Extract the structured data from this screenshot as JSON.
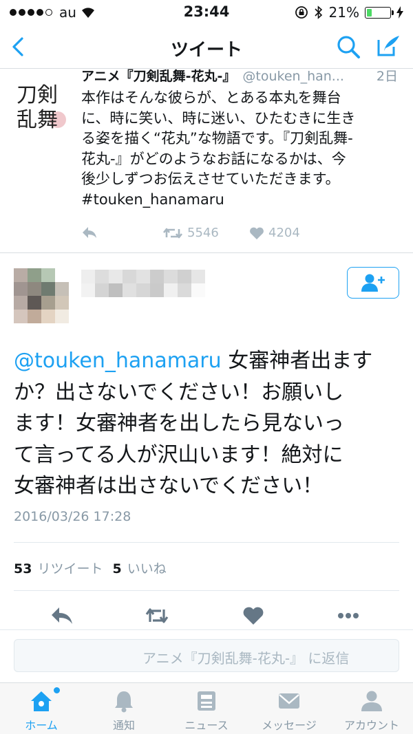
{
  "status_bar": {
    "carrier": "au",
    "time": "23:44",
    "battery": "21%",
    "battery_level": 0.21
  },
  "nav": {
    "title": "ツイート"
  },
  "quoted_tweet": {
    "name": "アニメ『刀剣乱舞-花丸-』",
    "handle": "@touken_han...",
    "date": "2日",
    "lines": [
      "本作はそんな彼らが、とある本丸を舞台",
      "に、時に笑い、時に迷い、ひたむきに生き",
      "る姿を描く“花丸”な物語です。『刀剣乱舞-",
      "花丸-』がどのようなお話になるかは、今",
      "後少しずつお伝えさせていただきます。",
      "#touken_hanamaru"
    ],
    "retweets": "5546",
    "likes": "4204",
    "avatar_text": "刀剣乱舞"
  },
  "main_tweet": {
    "mention": "@touken_hanamaru",
    "lines": [
      " 女審神者出ます",
      "か？出さないでください！お願いし",
      "ます！女審神者を出したら見ないっ",
      "て言ってる人が沢山います！絶対に",
      "女審神者は出さないでください！"
    ],
    "timestamp": "2016/03/26 17:28",
    "retweet_count": "53",
    "retweet_label": "リツイート",
    "like_count": "5",
    "like_label": "いいね"
  },
  "reply": {
    "placeholder": "アニメ『刀剣乱舞-花丸-』 に返信"
  },
  "tabs": [
    {
      "label": "ホーム",
      "icon": "home-icon"
    },
    {
      "label": "通知",
      "icon": "bell-icon"
    },
    {
      "label": "ニュース",
      "icon": "news-icon"
    },
    {
      "label": "メッセージ",
      "icon": "mail-icon"
    },
    {
      "label": "アカウント",
      "icon": "account-icon"
    }
  ],
  "colors": {
    "accent": "#1da1f2",
    "muted": "#8899a6",
    "action": "#aab8c2"
  }
}
